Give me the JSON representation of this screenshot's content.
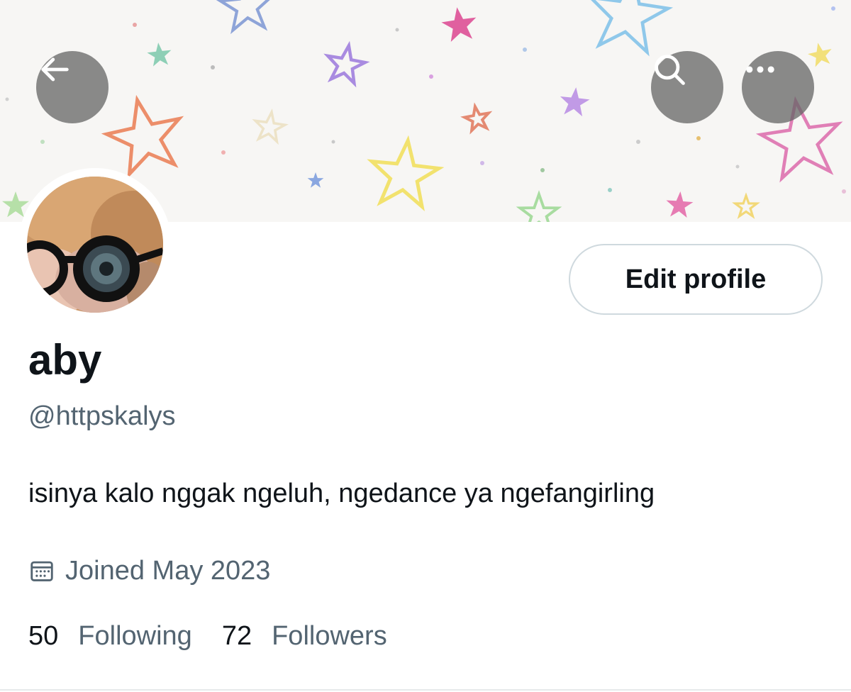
{
  "profile": {
    "name": "aby",
    "handle": "@httpskalys",
    "bio": "isinya kalo nggak ngeluh, ngedance ya ngefangirling",
    "joined": "Joined May 2023",
    "following_count": "50",
    "following_label": "Following",
    "followers_count": "72",
    "followers_label": "Followers"
  },
  "actions": {
    "edit_profile_label": "Edit profile"
  },
  "icons": {
    "back": "arrow-left-icon",
    "search": "search-icon",
    "more": "more-horizontal-icon",
    "calendar": "calendar-icon"
  },
  "colors": {
    "primary_text": "#0f1419",
    "secondary_text": "#536471",
    "button_border": "#cfd9de",
    "overlay_button": "#646464"
  }
}
